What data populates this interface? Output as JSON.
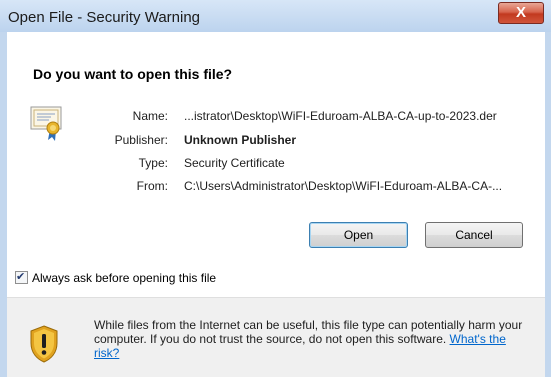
{
  "window": {
    "title": "Open File - Security Warning",
    "close_label": "X"
  },
  "dialog": {
    "question": "Do you want to open this file?",
    "fields": {
      "name_label": "Name:",
      "name_value": "...istrator\\Desktop\\WiFI-Eduroam-ALBA-CA-up-to-2023.der",
      "publisher_label": "Publisher:",
      "publisher_value": "Unknown Publisher",
      "type_label": "Type:",
      "type_value": "Security Certificate",
      "from_label": "From:",
      "from_value": "C:\\Users\\Administrator\\Desktop\\WiFI-Eduroam-ALBA-CA-..."
    },
    "buttons": {
      "open_label": "Open",
      "cancel_label": "Cancel"
    },
    "always_ask": {
      "label": "Always ask before opening this file",
      "checked": true
    },
    "warning": {
      "text": "While files from the Internet can be useful, this file type can potentially harm your computer. If you do not trust the source, do not open this software.",
      "link_text": "What's the risk?"
    }
  },
  "colors": {
    "link": "#0066cc",
    "close_button": "#c2391f",
    "title_bar": "#c9ddf2",
    "info_band": "#f0f0f0"
  }
}
